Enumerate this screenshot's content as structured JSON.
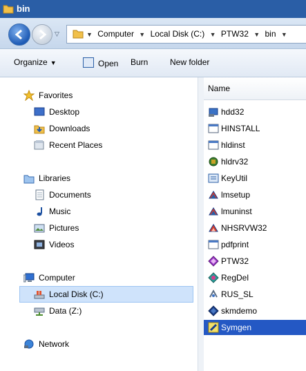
{
  "window": {
    "title": "bin"
  },
  "address": {
    "crumbs": [
      "Computer",
      "Local Disk (C:)",
      "PTW32",
      "bin"
    ]
  },
  "toolbar": {
    "organize": "Organize",
    "open": "Open",
    "burn": "Burn",
    "new_folder": "New folder"
  },
  "nav": {
    "favorites": "Favorites",
    "desktop": "Desktop",
    "downloads": "Downloads",
    "recent_places": "Recent Places",
    "libraries": "Libraries",
    "documents": "Documents",
    "music": "Music",
    "pictures": "Pictures",
    "videos": "Videos",
    "computer": "Computer",
    "local_disk": "Local Disk (C:)",
    "data_z": "Data (Z:)",
    "network": "Network"
  },
  "files": {
    "column_name": "Name",
    "items": [
      "hdd32",
      "HINSTALL",
      "hldinst",
      "hldrv32",
      "KeyUtil",
      "lmsetup",
      "lmuninst",
      "NHSRVW32",
      "pdfprint",
      "PTW32",
      "RegDel",
      "RUS_SL",
      "skmdemo",
      "Symgen"
    ],
    "selected": "Symgen"
  },
  "colors": {
    "titlebar": "#2a5ea6",
    "selection": "#2458c4",
    "nav_selection": "#cfe3fb"
  }
}
